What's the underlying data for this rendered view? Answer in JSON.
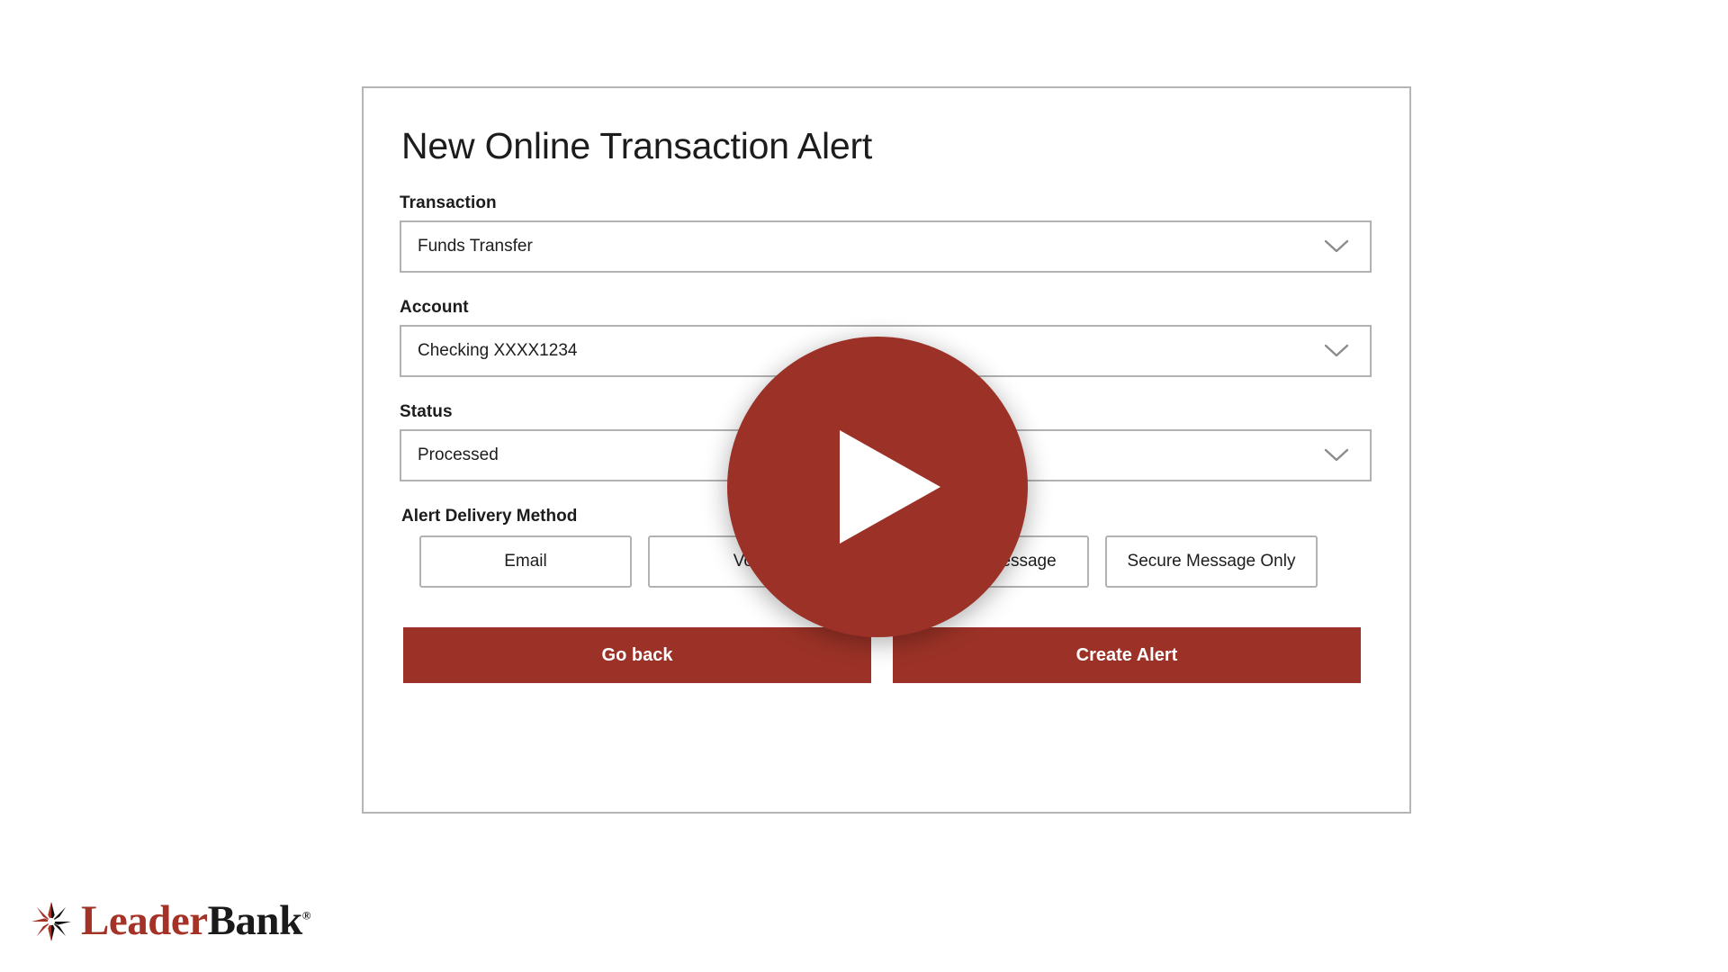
{
  "card": {
    "title": "New Online Transaction Alert",
    "fields": [
      {
        "label": "Transaction",
        "value": "Funds Transfer",
        "icon": "chevron-down-icon"
      },
      {
        "label": "Account",
        "value": "Checking XXXX1234",
        "icon": "chevron-down-icon"
      },
      {
        "label": "Status",
        "value": "Processed",
        "icon": "chevron-down-icon"
      }
    ],
    "delivery": {
      "label": "Alert Delivery Method",
      "options": [
        "Email",
        "Voice",
        "SMS Text Message",
        "Secure Message Only"
      ]
    },
    "actions": {
      "back_label": "Go back",
      "submit_label": "Create Alert"
    }
  },
  "overlay": {
    "icon": "play-icon"
  },
  "logo": {
    "mark": "starburst-icon",
    "word_primary": "Leader",
    "word_secondary": "Bank",
    "trademark": "®"
  },
  "colors": {
    "brand_red": "#9c3227",
    "logo_red": "#a43226",
    "border_gray": "#b2b2b2",
    "card_border": "#b5b5b5",
    "text_dark": "#1c1c1c"
  }
}
